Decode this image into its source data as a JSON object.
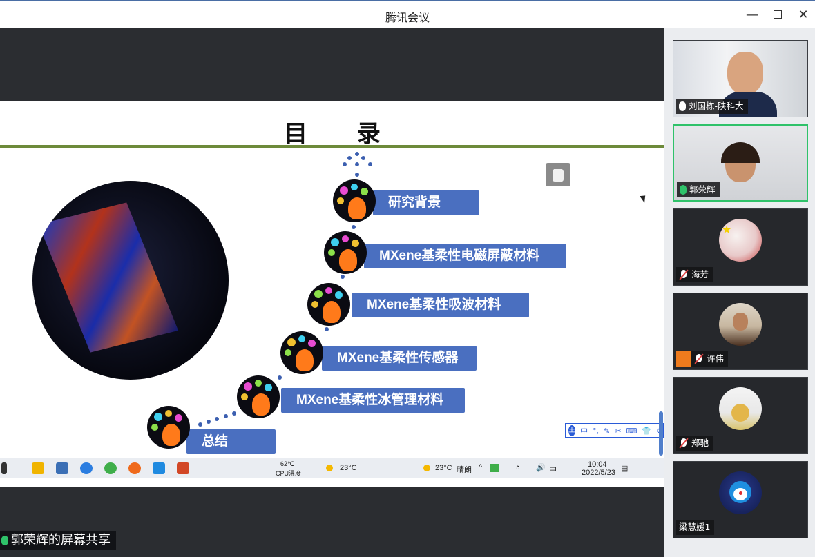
{
  "window": {
    "title": "腾讯会议",
    "controls": [
      "minimize",
      "maximize",
      "close"
    ]
  },
  "slide": {
    "title": "目 录",
    "menu": [
      "研究背景",
      "MXene基柔性电磁屏蔽材料",
      "MXene基柔性吸波材料",
      "MXene基柔性传感器",
      "MXene基柔性冰管理材料",
      "总结"
    ]
  },
  "ime_toolbar": {
    "logo": "王",
    "mode": "中"
  },
  "taskbar": {
    "cpu_temp": "62℃",
    "cpu_label": "CPU温度",
    "weather_left": "23°C",
    "weather_right": "23°C",
    "weather_text": "晴朗",
    "time": "10:04",
    "date": "2022/5/23",
    "ime_mode": "中"
  },
  "share_label": "郭荣辉的屏幕共享",
  "participants": [
    {
      "name": "刘国栋-陕科大",
      "mic": "on",
      "type": "video"
    },
    {
      "name": "郭荣辉",
      "mic": "on-active",
      "type": "video"
    },
    {
      "name": "海芳",
      "mic": "off",
      "type": "avatar"
    },
    {
      "name": "许伟",
      "mic": "off",
      "type": "avatar",
      "host_badge": true
    },
    {
      "name": "郑驰",
      "mic": "off",
      "type": "avatar"
    },
    {
      "name": "梁慧媛1",
      "mic": "none",
      "type": "avatar"
    }
  ],
  "colors": {
    "menu_bar": "#4a6fc0",
    "title_rule": "#6d8a3a",
    "active_speaker": "#2fc26a",
    "stage_bg": "#2b2d31",
    "sidebar_bg": "#ebedf0"
  }
}
